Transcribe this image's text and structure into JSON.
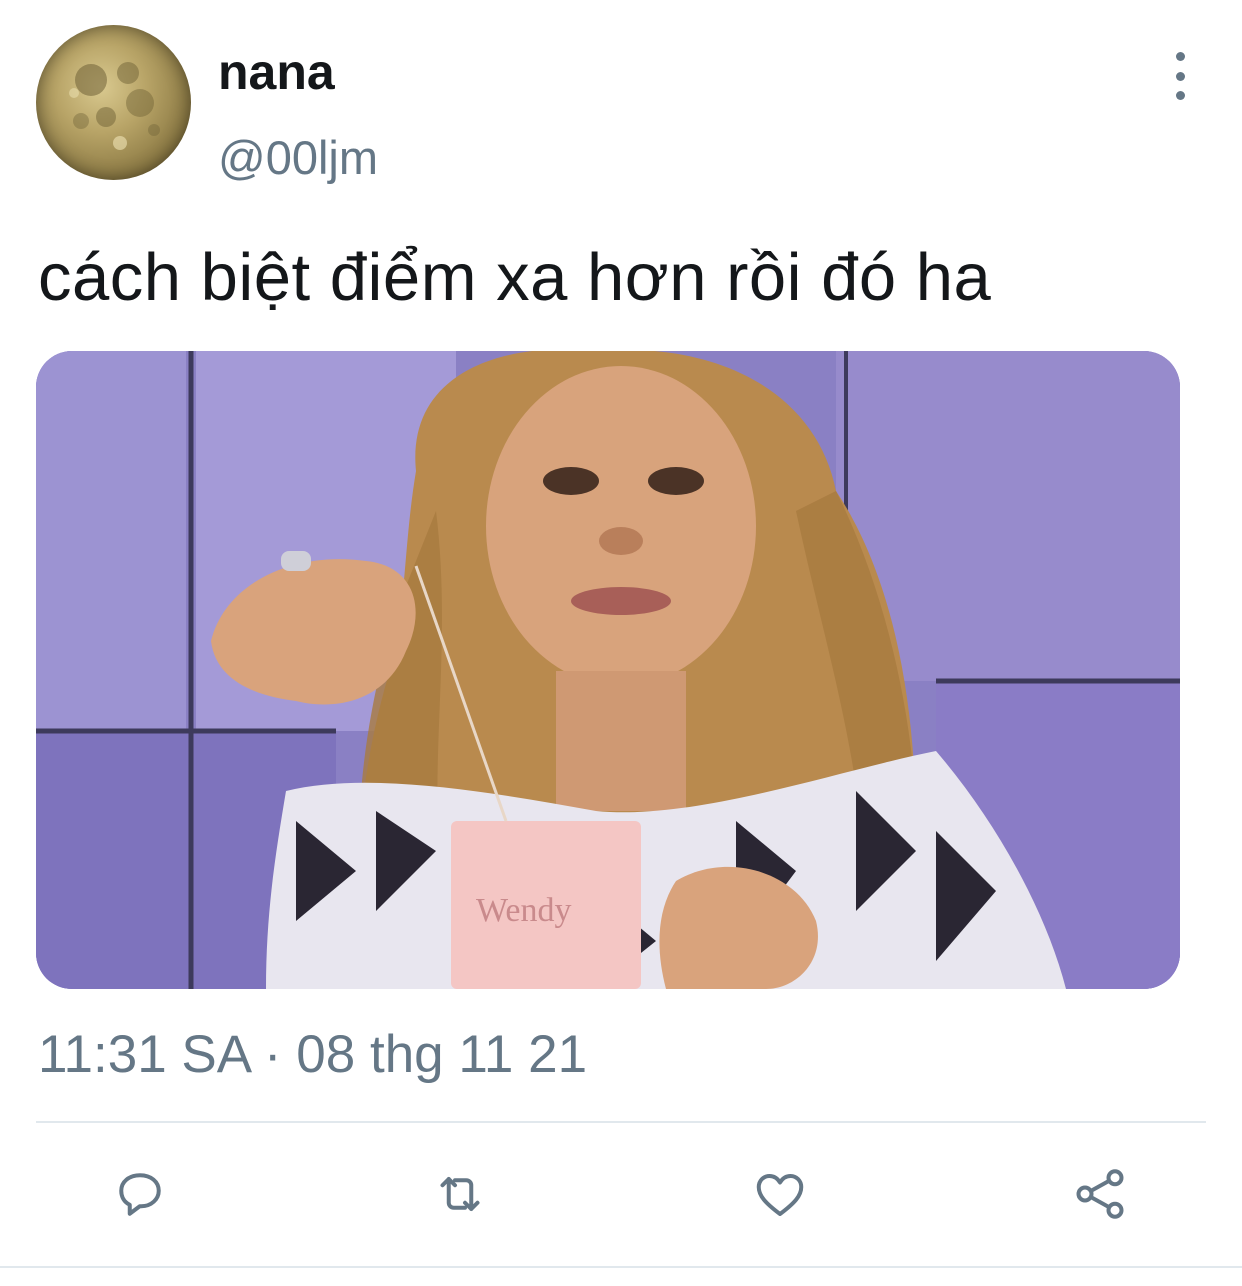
{
  "user": {
    "display_name": "nana",
    "handle": "@00ljm",
    "avatar_icon": "full-moon-avatar"
  },
  "tweet": {
    "text": "cách biệt điểm xa hơn rồi đó ha",
    "timestamp": "11:31 SA · 08 thg 11 21",
    "media_description_icon": "photo-meme"
  },
  "icons": {
    "more": "more-vertical-icon",
    "reply": "reply-icon",
    "retweet": "retweet-icon",
    "like": "heart-icon",
    "share": "share-icon"
  },
  "colors": {
    "primary_text": "#14171a",
    "secondary_text": "#657786",
    "divider": "#e1e8ed"
  }
}
